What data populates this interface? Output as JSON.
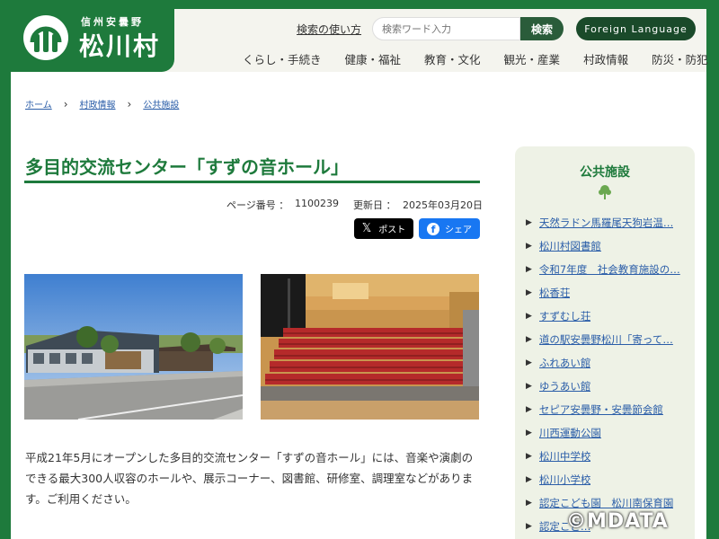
{
  "header": {
    "logo_sub": "信州安曇野",
    "logo_main": "松川村",
    "search_help": "検索の使い方",
    "search_placeholder": "検索ワード入力",
    "search_button": "検索",
    "foreign_button": "Foreign Language",
    "nav": [
      "くらし・手続き",
      "健康・福祉",
      "教育・文化",
      "観光・産業",
      "村政情報",
      "防災・防犯"
    ]
  },
  "breadcrumb": [
    "ホーム",
    "村政情報",
    "公共施設"
  ],
  "main": {
    "title": "多目的交流センター「すずの音ホール」",
    "page_number_label": "ページ番号 ：",
    "page_number": "1100239",
    "updated_label": "更新日 ：",
    "updated": "2025年03月20日",
    "post_label": "ポスト",
    "share_label": "シェア",
    "body_text": "平成21年5月にオープンした多目的交流センター「すずの音ホール」には、音楽や演劇のできる最大300人収容のホールや、展示コーナー、図書館、研修室、調理室などがあります。ご利用ください。"
  },
  "sidebar": {
    "title": "公共施設",
    "items": [
      "天然ラドン馬羅尾天狗岩温…",
      "松川村図書館",
      "令和7年度　社会教育施設の…",
      "松香荘",
      "すずむし荘",
      "道の駅安曇野松川「寄って…",
      "ふれあい館",
      "ゆうあい館",
      "セピア安曇野・安曇節会館",
      "川西運動公園",
      "松川中学校",
      "松川小学校",
      "認定こども園　松川南保育園",
      "認定こど…"
    ]
  },
  "watermark": "©MDATA",
  "colors": {
    "brand_green": "#1e7a3c",
    "link_blue": "#2a5da8",
    "sidebar_bg": "#eef2e6"
  }
}
